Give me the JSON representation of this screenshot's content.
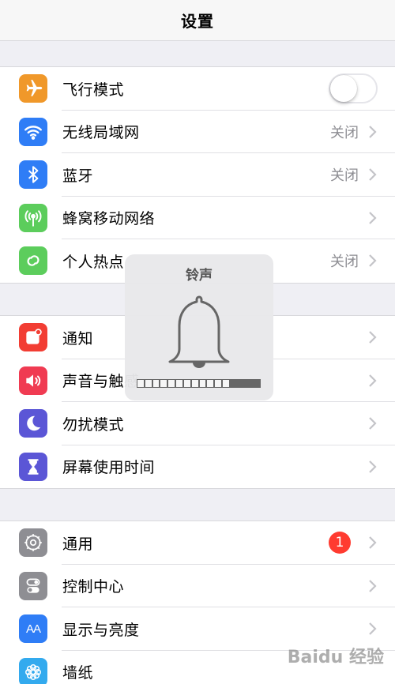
{
  "nav": {
    "title": "设置"
  },
  "groups": [
    {
      "rows": [
        {
          "label": "飞行模式",
          "icon": "airplane-icon",
          "color": "#f0982a",
          "toggle": true,
          "toggle_on": false
        },
        {
          "label": "无线局域网",
          "icon": "wifi-icon",
          "color": "#2f7df6",
          "value": "关闭"
        },
        {
          "label": "蓝牙",
          "icon": "bluetooth-icon",
          "color": "#2f7df6",
          "value": "关闭"
        },
        {
          "label": "蜂窝移动网络",
          "icon": "antenna-icon",
          "color": "#5ccd5c"
        },
        {
          "label": "个人热点",
          "icon": "hotspot-icon",
          "color": "#5ccd5c",
          "value": "关闭"
        }
      ]
    },
    {
      "rows": [
        {
          "label": "通知",
          "icon": "notification-icon",
          "color": "#f23d33"
        },
        {
          "label": "声音与触感",
          "icon": "speaker-icon",
          "color": "#f03b52"
        },
        {
          "label": "勿扰模式",
          "icon": "moon-icon",
          "color": "#5b56d6"
        },
        {
          "label": "屏幕使用时间",
          "icon": "hourglass-icon",
          "color": "#5b56d6"
        }
      ]
    },
    {
      "rows": [
        {
          "label": "通用",
          "icon": "gear-icon",
          "color": "#8e8e93",
          "badge": "1"
        },
        {
          "label": "控制中心",
          "icon": "switches-icon",
          "color": "#8e8e93"
        },
        {
          "label": "显示与亮度",
          "icon": "text-size-icon",
          "color": "#2f7df6",
          "icon_text": "AA"
        },
        {
          "label": "墙纸",
          "icon": "flower-icon",
          "color": "#33aaee"
        }
      ]
    }
  ],
  "hud": {
    "title": "铃声",
    "icon": "bell-icon",
    "level": 0.76
  },
  "watermark": "Baidu 经验"
}
